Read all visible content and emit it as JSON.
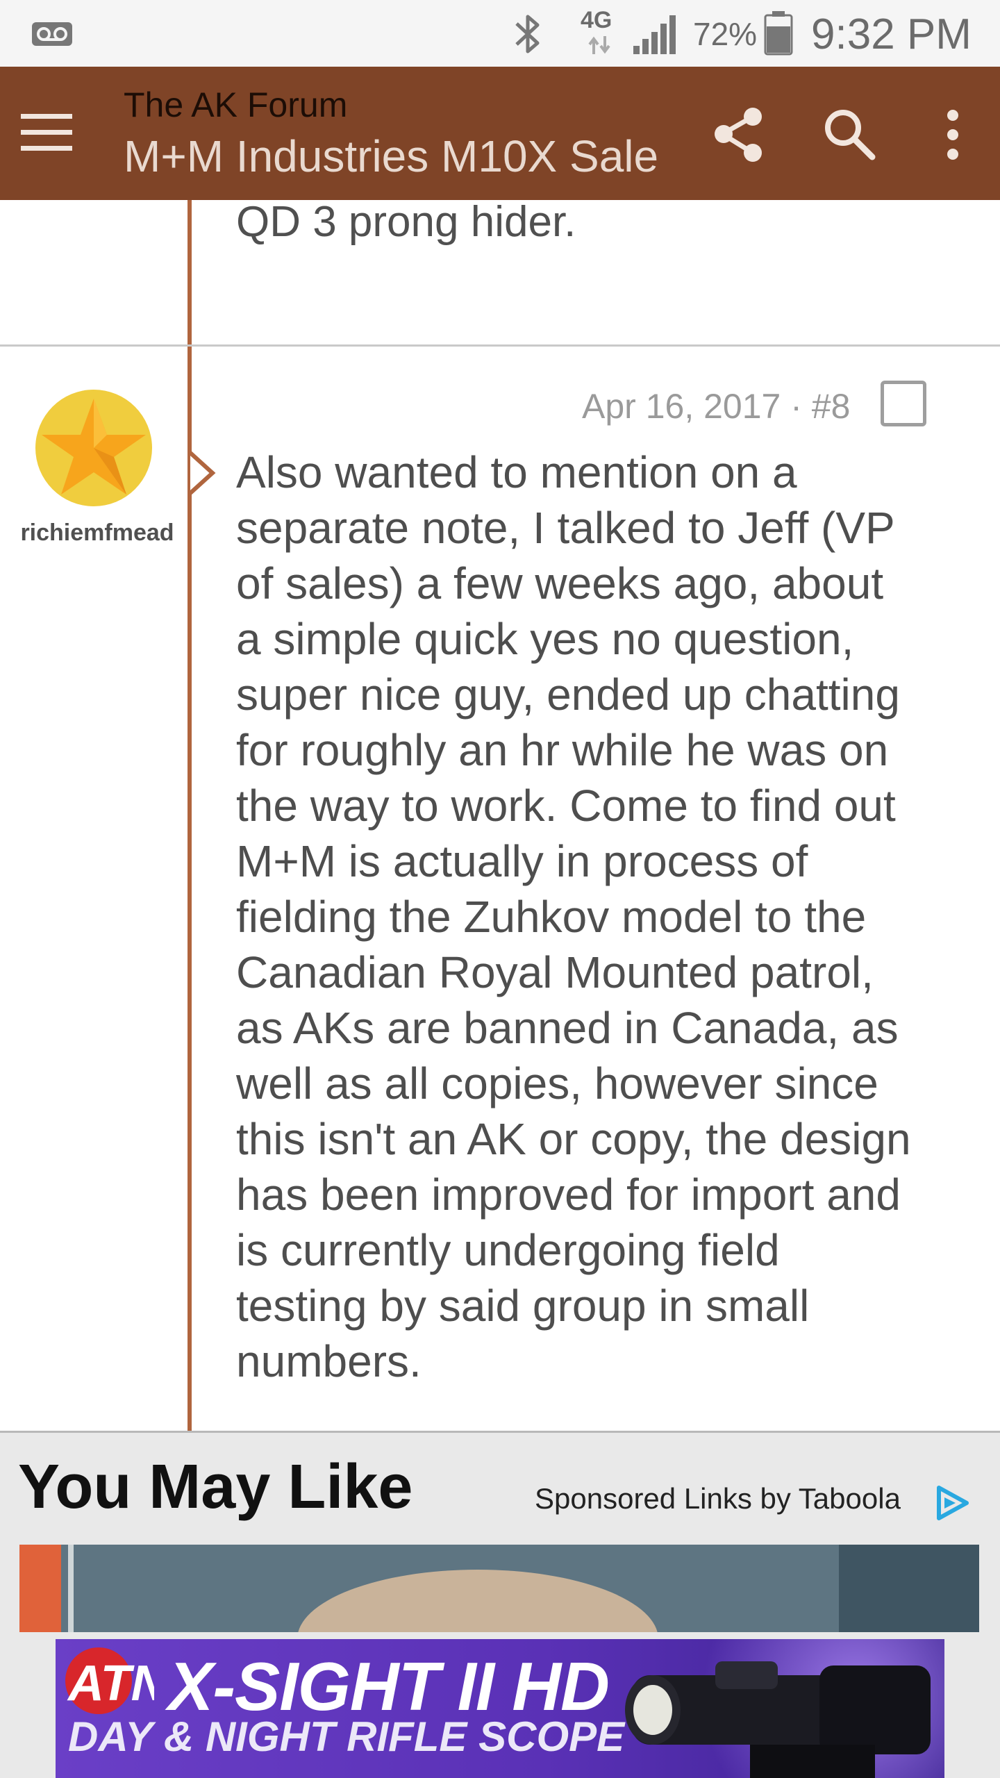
{
  "status_bar": {
    "network": "4G",
    "battery": "72%",
    "time": "9:32 PM"
  },
  "app_bar": {
    "forum_name": "The AK Forum",
    "thread_title": "M+M Industries M10X Sale"
  },
  "previous_post": {
    "text_tail": "QD 3 prong hider."
  },
  "post": {
    "username": "richiemfmead",
    "date": "Apr 16, 2017",
    "number": "#8",
    "body": "Also wanted to mention on a\nseparate note, I talked to Jeff (VP\nof sales) a few weeks ago, about\na simple quick yes no question,\nsuper nice guy, ended up chatting\nfor roughly an hr while he was on\nthe way to work. Come to find out\nM+M is actually in process of\nfielding the Zuhkov model to the\nCanadian Royal Mounted patrol,\nas AKs are banned in Canada, as\nwell as all copies, however since\nthis isn't an AK or copy, the design\nhas been improved for import and\nis currently undergoing field\ntesting by said group in small\nnumbers."
  },
  "sponsored": {
    "heading": "You May Like",
    "attribution": "Sponsored Links by Taboola"
  },
  "ad": {
    "brand": "ATN",
    "headline": "X-SIGHT II HD",
    "subline": "DAY & NIGHT RIFLE SCOPE"
  },
  "colors": {
    "app_bar": "#7f4427",
    "accent_line": "#b0653e",
    "ad_background": "#5b33b8"
  }
}
